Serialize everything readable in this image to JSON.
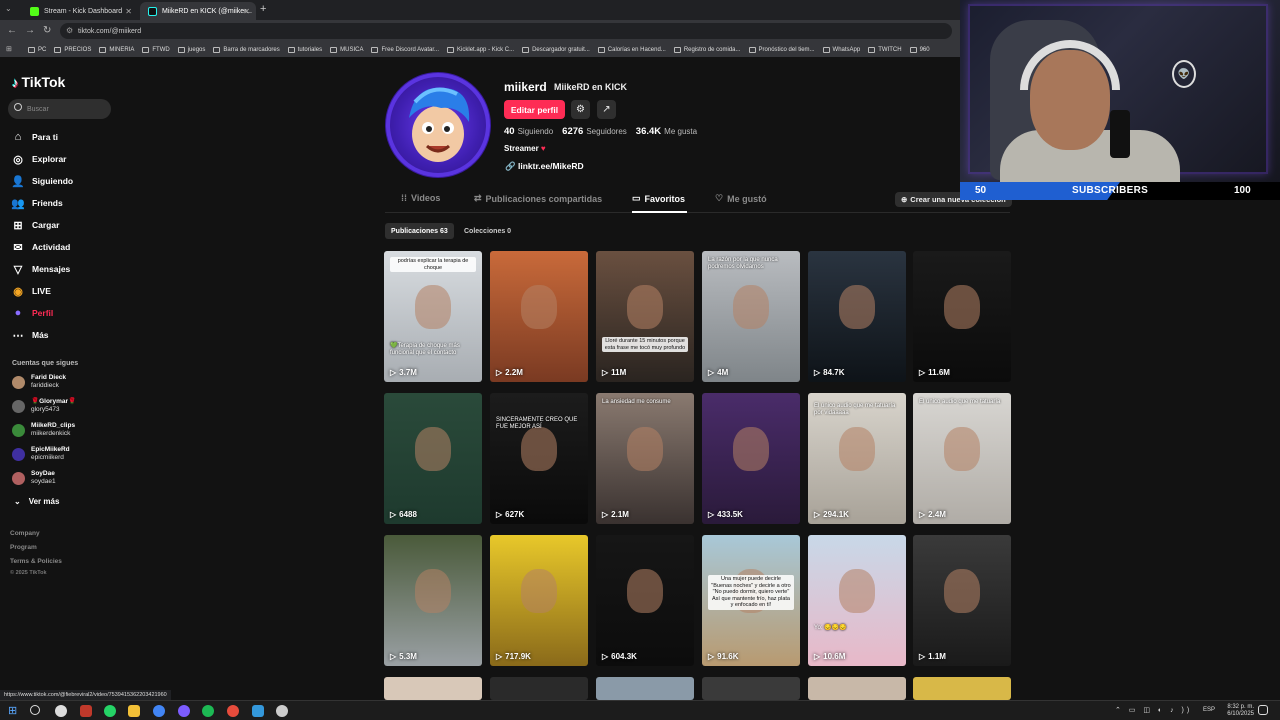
{
  "browser": {
    "tabs": [
      {
        "title": "Stream - Kick Dashboard",
        "active": false
      },
      {
        "title": "MiikeRD en KICK (@miiker...",
        "active": true
      }
    ],
    "url": "tiktok.com/@miikerd",
    "bookmarks": [
      "PC",
      "PRECIOS",
      "MINERIA",
      "FTWD",
      "juegos",
      "Barra de marcadores",
      "tutoriales",
      "MUSICA",
      "Free Discord Avatar...",
      "Kicklet.app - Kick C...",
      "Descargador gratuit...",
      "Calorías en Hacend...",
      "Registro de comida...",
      "Pronóstico del tiem...",
      "WhatsApp",
      "TWITCH",
      "960"
    ],
    "status_url": "https://www.tiktok.com/@fiebreviral2/video/7539415362203421960"
  },
  "sidebar": {
    "logo": "TikTok",
    "search_placeholder": "Buscar",
    "nav": [
      {
        "label": "Para ti",
        "icon": "home-icon"
      },
      {
        "label": "Explorar",
        "icon": "compass-icon"
      },
      {
        "label": "Siguiendo",
        "icon": "following-icon"
      },
      {
        "label": "Friends",
        "icon": "friends-icon"
      },
      {
        "label": "Cargar",
        "icon": "upload-icon"
      },
      {
        "label": "Actividad",
        "icon": "activity-icon"
      },
      {
        "label": "Mensajes",
        "icon": "messages-icon"
      },
      {
        "label": "LIVE",
        "icon": "live-icon"
      },
      {
        "label": "Perfil",
        "icon": "profile-icon"
      },
      {
        "label": "Más",
        "icon": "more-icon"
      }
    ],
    "following_header": "Cuentas que sigues",
    "following": [
      {
        "name": "Farid Dieck",
        "handle": "fariddieck",
        "color": "#b08a6a"
      },
      {
        "name": "🌹Glorymar🌹",
        "handle": "glory5473",
        "color": "#666"
      },
      {
        "name": "MiikeRD_clips",
        "handle": "miikerdenkick",
        "color": "#3a8a3a"
      },
      {
        "name": "EpicMiikeRd",
        "handle": "epicmiikerd",
        "color": "#3f2fa0"
      },
      {
        "name": "SoyDae",
        "handle": "soydae1",
        "color": "#b06060"
      }
    ],
    "see_more": "Ver más",
    "footer": [
      "Company",
      "Program",
      "Terms & Policies",
      "© 2025 TikTok"
    ]
  },
  "profile": {
    "username": "miikerd",
    "display_name": "MiikeRD en KICK",
    "edit_label": "Editar perfil",
    "following_count": "40",
    "following_label": "Siguiendo",
    "followers_count": "6276",
    "followers_label": "Seguidores",
    "likes_count": "36.4K",
    "likes_label": "Me gusta",
    "bio": "Streamer",
    "link": "linktr.ee/MikeRD"
  },
  "tabs": [
    "Videos",
    "Publicaciones compartidas",
    "Favoritos",
    "Me gustó"
  ],
  "active_tab": "Favoritos",
  "create_collection": "Crear una nueva colección",
  "subtabs": {
    "posts": "Publicaciones 63",
    "collections": "Colecciones 0"
  },
  "videos": [
    {
      "views": "3.7M",
      "bg": "linear-gradient(180deg,#d8dce0,#a8adb2)",
      "caption": "💚Terapia de choque más funcional que el contacto",
      "capw": true,
      "capTop": 92,
      "topcap": "podrías explicar la terapia de choque"
    },
    {
      "views": "2.2M",
      "bg": "linear-gradient(180deg,#c96a3a,#7a3a22)"
    },
    {
      "views": "11M",
      "bg": "linear-gradient(180deg,#6a5040,#2a2420)",
      "caption": "Lloré durante 15 minutos porque esta frase me tocó muy profundo",
      "capTop": 86
    },
    {
      "views": "4M",
      "bg": "linear-gradient(180deg,#b9bcc0,#7f8589)",
      "capw": true,
      "caption": "La razón por la que nunca podremos olvidarnos",
      "capTop": 6
    },
    {
      "views": "84.7K",
      "bg": "linear-gradient(180deg,#2a3440,#0e1318)"
    },
    {
      "views": "11.6M",
      "bg": "linear-gradient(180deg,#1a1a1a,#0b0b0b)"
    },
    {
      "views": "6488",
      "bg": "linear-gradient(180deg,#2a4a3a,#1e3a2e)"
    },
    {
      "views": "627K",
      "bg": "linear-gradient(180deg,#1c1c1c,#0a0a0a)",
      "capw": true,
      "caption": "SINCERAMENTE CREO QUE FUE MEJOR ASÍ",
      "capTop": 24
    },
    {
      "views": "2.1M",
      "bg": "linear-gradient(180deg,#8a7a70,#3a3230)",
      "capw": true,
      "caption": "La ansiedad me consume",
      "capTop": 6
    },
    {
      "views": "433.5K",
      "bg": "linear-gradient(180deg,#4a2c6a,#2a1a3a)"
    },
    {
      "views": "294.1K",
      "bg": "linear-gradient(180deg,#d8d4cc,#a8a298)",
      "capw": true,
      "caption": "El único audio que me tatuaría por vidaaaaa",
      "capTop": 10
    },
    {
      "views": "2.4M",
      "bg": "linear-gradient(180deg,#d8d6d2,#b0aca6)",
      "capw": true,
      "caption": "El único audio que me tatuaría",
      "capTop": 6
    },
    {
      "views": "5.3M",
      "bg": "linear-gradient(180deg,#4a5a3a,#9aa0a4)"
    },
    {
      "views": "717.9K",
      "bg": "linear-gradient(180deg,#e8c82a,#8a6a1a)"
    },
    {
      "views": "604.3K",
      "bg": "linear-gradient(180deg,#161616,#0c0c0c)"
    },
    {
      "views": "91.6K",
      "bg": "linear-gradient(180deg,#a8c8d8,#b89a70)",
      "caption": "Una mujer puede decirle \"Buenas noches\" y decirle a otro \"No puedo dormir, quiero verte\" Así que mantente frío, haz plata y enfocado en tí!",
      "capTop": 40
    },
    {
      "views": "10.6M",
      "bg": "linear-gradient(180deg,#c8d8e8,#e8b8c8)",
      "capw": true,
      "caption": "Yo: 😔😔😔",
      "capTop": 90
    },
    {
      "views": "1.1M",
      "bg": "linear-gradient(180deg,#3a3a3a,#1a1a1a)"
    }
  ],
  "stream_overlay": {
    "current": "50",
    "label": "SUBSCRIBERS",
    "goal": "100",
    "progress": 0.5
  },
  "taskbar": {
    "time": "8:32 p. m.",
    "date": "6/10/2025",
    "lang": "ESP"
  }
}
